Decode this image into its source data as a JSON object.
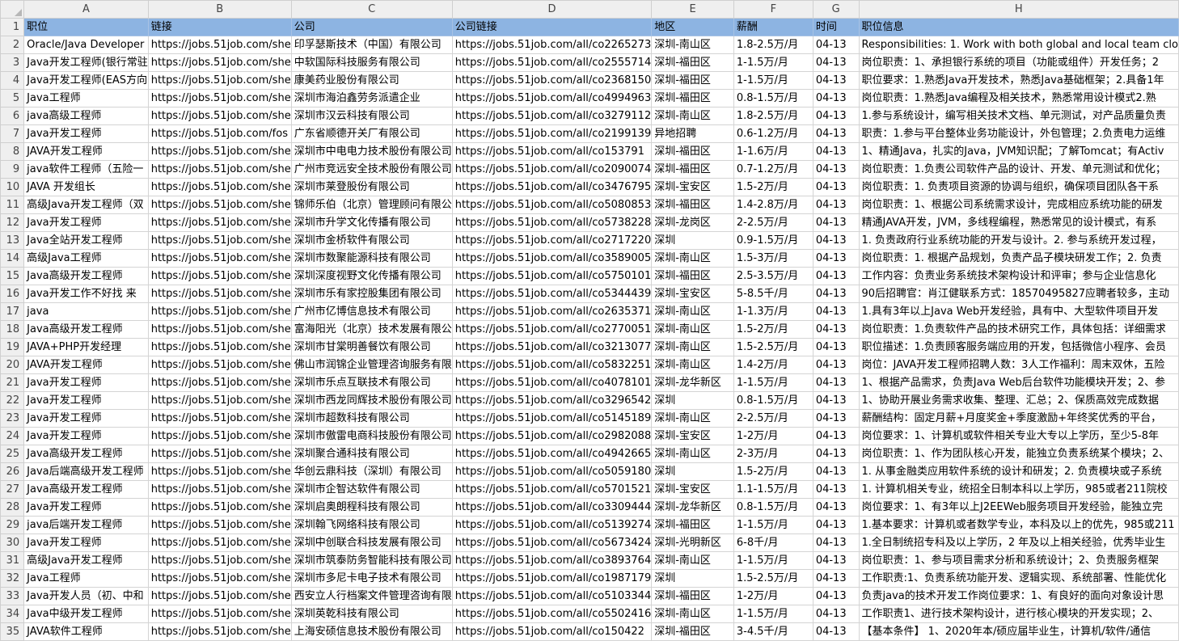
{
  "columns": [
    "A",
    "B",
    "C",
    "D",
    "E",
    "F",
    "G",
    "H"
  ],
  "header": [
    "职位",
    "链接",
    "公司",
    "公司链接",
    "地区",
    "薪酬",
    "时间",
    "职位信息"
  ],
  "rows": [
    {
      "n": "2",
      "cells": [
        "Oracle/Java Developer",
        "https://jobs.51job.com/she",
        "印孚瑟斯技术（中国）有限公司",
        "https://jobs.51job.com/all/co2265273",
        "深圳-南山区",
        "1.8-2.5万/月",
        "04-13",
        "Responsibilities: 1. Work with both global and local team clo"
      ]
    },
    {
      "n": "3",
      "cells": [
        "Java开发工程师(银行常驻",
        "https://jobs.51job.com/she",
        "中软国际科技服务有限公司",
        "https://jobs.51job.com/all/co2555714",
        "深圳-福田区",
        "1-1.5万/月",
        "04-13",
        "岗位职责：1、承担银行系统的项目（功能或组件）开发任务；2"
      ]
    },
    {
      "n": "4",
      "cells": [
        "Java开发工程师(EAS方向",
        "https://jobs.51job.com/she",
        "康美药业股份有限公司",
        "https://jobs.51job.com/all/co2368150",
        "深圳-福田区",
        "1-1.5万/月",
        "04-13",
        "职位要求：1.熟悉Java开发技术，熟悉Java基础框架；2.具备1年"
      ]
    },
    {
      "n": "5",
      "cells": [
        "Java工程师",
        "https://jobs.51job.com/she",
        "深圳市海泊鑫劳务派遣企业",
        "https://jobs.51job.com/all/co4994963",
        "深圳-福田区",
        "0.8-1.5万/月",
        "04-13",
        "岗位职责：1.熟悉Java编程及相关技术，熟悉常用设计模式2.熟"
      ]
    },
    {
      "n": "6",
      "cells": [
        "java高级工程师",
        "https://jobs.51job.com/she",
        "深圳市汉云科技有限公司",
        "https://jobs.51job.com/all/co3279112",
        "深圳-南山区",
        "1.8-2.5万/月",
        "04-13",
        "1.参与系统设计，编写相关技术文档、单元测试，对产品质量负责"
      ]
    },
    {
      "n": "7",
      "cells": [
        "Java开发工程师",
        "https://jobs.51job.com/fos",
        "广东省顺德开关厂有限公司",
        "https://jobs.51job.com/all/co2199139",
        "异地招聘",
        "0.6-1.2万/月",
        "04-13",
        "职责：1.参与平台整体业务功能设计，外包管理；2.负责电力运维"
      ]
    },
    {
      "n": "8",
      "cells": [
        "JAVA开发工程师",
        "https://jobs.51job.com/she",
        "深圳市中电电力技术股份有限公司",
        "https://jobs.51job.com/all/co153791",
        "深圳-福田区",
        "1-1.6万/月",
        "04-13",
        "1、精通Java，扎实的Java，JVM知识配；了解Tomcat；有Activ"
      ]
    },
    {
      "n": "9",
      "cells": [
        "java软件工程师（五险一",
        "https://jobs.51job.com/she",
        "广州市竞远安全技术股份有限公司",
        "https://jobs.51job.com/all/co2090074",
        "深圳-福田区",
        "0.7-1.2万/月",
        "04-13",
        "岗位职责：1.负责公司软件产品的设计、开发、单元测试和优化；"
      ]
    },
    {
      "n": "10",
      "cells": [
        "JAVA 开发组长",
        "https://jobs.51job.com/she",
        "深圳市莱登股份有限公司",
        "https://jobs.51job.com/all/co3476795",
        "深圳-宝安区",
        "1.5-2万/月",
        "04-13",
        "岗位职责：1. 负责项目资源的协调与组织，确保项目团队各干系"
      ]
    },
    {
      "n": "11",
      "cells": [
        "高级Java开发工程师（双",
        "https://jobs.51job.com/she",
        "锦师乐伯（北京）管理顾问有限公",
        "https://jobs.51job.com/all/co5080853",
        "深圳-福田区",
        "1.4-2.8万/月",
        "04-13",
        "岗位职责：1、根据公司系统需求设计，完成相应系统功能的研发"
      ]
    },
    {
      "n": "12",
      "cells": [
        "Java开发工程师",
        "https://jobs.51job.com/she",
        "深圳市升学文化传播有限公司",
        "https://jobs.51job.com/all/co5738228",
        "深圳-龙岗区",
        "2-2.5万/月",
        "04-13",
        "精通JAVA开发，JVM，多线程编程，熟悉常见的设计模式，有系"
      ]
    },
    {
      "n": "13",
      "cells": [
        "Java全站开发工程师",
        "https://jobs.51job.com/she",
        "深圳市金桥软件有限公司",
        "https://jobs.51job.com/all/co2717220",
        "深圳",
        "0.9-1.5万/月",
        "04-13",
        "1. 负责政府行业系统功能的开发与设计。2. 参与系统开发过程，"
      ]
    },
    {
      "n": "14",
      "cells": [
        "高级Java工程师",
        "https://jobs.51job.com/she",
        "深圳市数聚能源科技有限公司",
        "https://jobs.51job.com/all/co3589005",
        "深圳-南山区",
        "1.5-3万/月",
        "04-13",
        "岗位职责：1. 根据产品规划，负责产品子模块研发工作；2. 负责"
      ]
    },
    {
      "n": "15",
      "cells": [
        "Java高级开发工程师",
        "https://jobs.51job.com/she",
        "深圳深度视野文化传播有限公司",
        "https://jobs.51job.com/all/co5750101",
        "深圳-福田区",
        "2.5-3.5万/月",
        "04-13",
        "工作内容：负责业务系统技术架构设计和评审；参与企业信息化"
      ]
    },
    {
      "n": "16",
      "cells": [
        "Java开发工作不好找 来",
        "https://jobs.51job.com/she",
        "深圳市乐有家控股集团有限公司",
        "https://jobs.51job.com/all/co5344439",
        "深圳-宝安区",
        "5-8.5千/月",
        "04-13",
        "90后招聘官：肖江健联系方式：18570495827应聘者较多，主动"
      ]
    },
    {
      "n": "17",
      "cells": [
        "java",
        "https://jobs.51job.com/she",
        "广州市亿博信息技术有限公司",
        "https://jobs.51job.com/all/co2635371",
        "深圳-南山区",
        "1-1.3万/月",
        "04-13",
        "1.具有3年以上Java Web开发经验，具有中、大型软件项目开发"
      ]
    },
    {
      "n": "18",
      "cells": [
        "Java高级开发工程师",
        "https://jobs.51job.com/she",
        "富海阳光（北京）技术发展有限公",
        "https://jobs.51job.com/all/co2770051",
        "深圳-南山区",
        "1.5-2万/月",
        "04-13",
        "岗位职责：1.负责软件产品的技术研究工作，具体包括：详细需求"
      ]
    },
    {
      "n": "19",
      "cells": [
        "JAVA+PHP开发经理",
        "https://jobs.51job.com/she",
        "深圳市甘棠明善餐饮有限公司",
        "https://jobs.51job.com/all/co3213077",
        "深圳-南山区",
        "1.5-2.5万/月",
        "04-13",
        "职位描述：1.负责顾客服务端应用的开发，包括微信小程序、会员"
      ]
    },
    {
      "n": "20",
      "cells": [
        "JAVA开发工程师",
        "https://jobs.51job.com/she",
        "佛山市润锦企业管理咨询服务有限",
        "https://jobs.51job.com/all/co5832251",
        "深圳-南山区",
        "1.4-2万/月",
        "04-13",
        "岗位：JAVA开发工程师招聘人数：3人工作福利：周末双休，五险"
      ]
    },
    {
      "n": "21",
      "cells": [
        "Java开发工程师",
        "https://jobs.51job.com/she",
        "深圳市乐点互联技术有限公司",
        "https://jobs.51job.com/all/co4078101",
        "深圳-龙华新区",
        "1-1.5万/月",
        "04-13",
        "1、根据产品需求，负责Java  Web后台软件功能模块开发；2、参"
      ]
    },
    {
      "n": "22",
      "cells": [
        "Java开发工程师",
        "https://jobs.51job.com/she",
        "深圳市西龙同辉技术股份有限公司",
        "https://jobs.51job.com/all/co3296542",
        "深圳",
        "0.8-1.5万/月",
        "04-13",
        "1、协助开展业务需求收集、整理、汇总；2、保质高效完成数据"
      ]
    },
    {
      "n": "23",
      "cells": [
        "Java开发工程师",
        "https://jobs.51job.com/she",
        "深圳市超数科技有限公司",
        "https://jobs.51job.com/all/co5145189",
        "深圳-南山区",
        "2-2.5万/月",
        "04-13",
        "薪酬结构：固定月薪+月度奖金+季度激励+年终奖优秀的平台，"
      ]
    },
    {
      "n": "24",
      "cells": [
        "Java开发工程师",
        "https://jobs.51job.com/she",
        "深圳市傲雷电商科技股份有限公司",
        "https://jobs.51job.com/all/co2982088",
        "深圳-宝安区",
        "1-2万/月",
        "04-13",
        "岗位要求：1、计算机或软件相关专业大专以上学历，至少5-8年"
      ]
    },
    {
      "n": "25",
      "cells": [
        "Java高级开发工程师",
        "https://jobs.51job.com/she",
        "深圳聚合通科技有限公司",
        "https://jobs.51job.com/all/co4942665",
        "深圳-南山区",
        "2-3万/月",
        "04-13",
        "岗位职责：1、作为团队核心开发，能独立负责系统某个模块；2、"
      ]
    },
    {
      "n": "26",
      "cells": [
        "Java后端高级开发工程师",
        "https://jobs.51job.com/she",
        "华创云鼎科技（深圳）有限公司",
        "https://jobs.51job.com/all/co5059180",
        "深圳",
        "1.5-2万/月",
        "04-13",
        "1. 从事金融类应用软件系统的设计和研发；2. 负责模块或子系统"
      ]
    },
    {
      "n": "27",
      "cells": [
        "Java高级开发工程师",
        "https://jobs.51job.com/she",
        "深圳市企智达软件有限公司",
        "https://jobs.51job.com/all/co5701521",
        "深圳-宝安区",
        "1.1-1.5万/月",
        "04-13",
        "1. 计算机相关专业，统招全日制本科以上学历，985或者211院校"
      ]
    },
    {
      "n": "28",
      "cells": [
        "Java开发工程师",
        "https://jobs.51job.com/she",
        "深圳启奥朗程科技有限公司",
        "https://jobs.51job.com/all/co3309444",
        "深圳-龙华新区",
        "0.8-1.5万/月",
        "04-13",
        "岗位要求：1、有3年以上J2EEWeb服务项目开发经验，能独立完"
      ]
    },
    {
      "n": "29",
      "cells": [
        "java后端开发工程师",
        "https://jobs.51job.com/she",
        "深圳翰飞网络科技有限公司",
        "https://jobs.51job.com/all/co5139274",
        "深圳-福田区",
        "1-1.5万/月",
        "04-13",
        "1.基本要求：计算机或者数学专业，本科及以上的优先，985或211"
      ]
    },
    {
      "n": "30",
      "cells": [
        "Java开发工程师",
        "https://jobs.51job.com/she",
        "深圳中创联合科技发展有限公司",
        "https://jobs.51job.com/all/co5673424",
        "深圳-光明新区",
        "6-8千/月",
        "04-13",
        "1.全日制统招专科及以上学历，2 年及以上相关经验，优秀毕业生"
      ]
    },
    {
      "n": "31",
      "cells": [
        "高级Java开发工程师",
        "https://jobs.51job.com/she",
        "深圳市筑泰防务智能科技有限公司",
        "https://jobs.51job.com/all/co3893764",
        "深圳-南山区",
        "1-1.5万/月",
        "04-13",
        "岗位职责：1、参与项目需求分析和系统设计；2、负责服务框架"
      ]
    },
    {
      "n": "32",
      "cells": [
        "Java工程师",
        "https://jobs.51job.com/she",
        "深圳市多尼卡电子技术有限公司",
        "https://jobs.51job.com/all/co1987179",
        "深圳",
        "1.5-2.5万/月",
        "04-13",
        "工作职责:1、负责系统功能开发、逻辑实现、系统部署、性能优化"
      ]
    },
    {
      "n": "33",
      "cells": [
        "Java开发人员（初、中和",
        "https://jobs.51job.com/she",
        "西安立人行档案文件管理咨询有限",
        "https://jobs.51job.com/all/co5103344",
        "深圳-福田区",
        "1-2万/月",
        "04-13",
        "负责java的技术开发工作岗位要求：1、有良好的面向对象设计思"
      ]
    },
    {
      "n": "34",
      "cells": [
        "Java中级开发工程师",
        "https://jobs.51job.com/she",
        "深圳英乾科技有限公司",
        "https://jobs.51job.com/all/co5502416",
        "深圳-南山区",
        "1-1.5万/月",
        "04-13",
        "工作职责1、进行技术架构设计，进行核心模块的开发实现；2、"
      ]
    },
    {
      "n": "35",
      "cells": [
        "JAVA软件工程师",
        "https://jobs.51job.com/she",
        "上海安硕信息技术股份有限公司",
        "https://jobs.51job.com/all/co150422",
        "深圳-福田区",
        "3-4.5千/月",
        "04-13",
        "【基本条件】  1、2020年本/硕应届毕业生，计算机/软件/通信"
      ]
    }
  ]
}
